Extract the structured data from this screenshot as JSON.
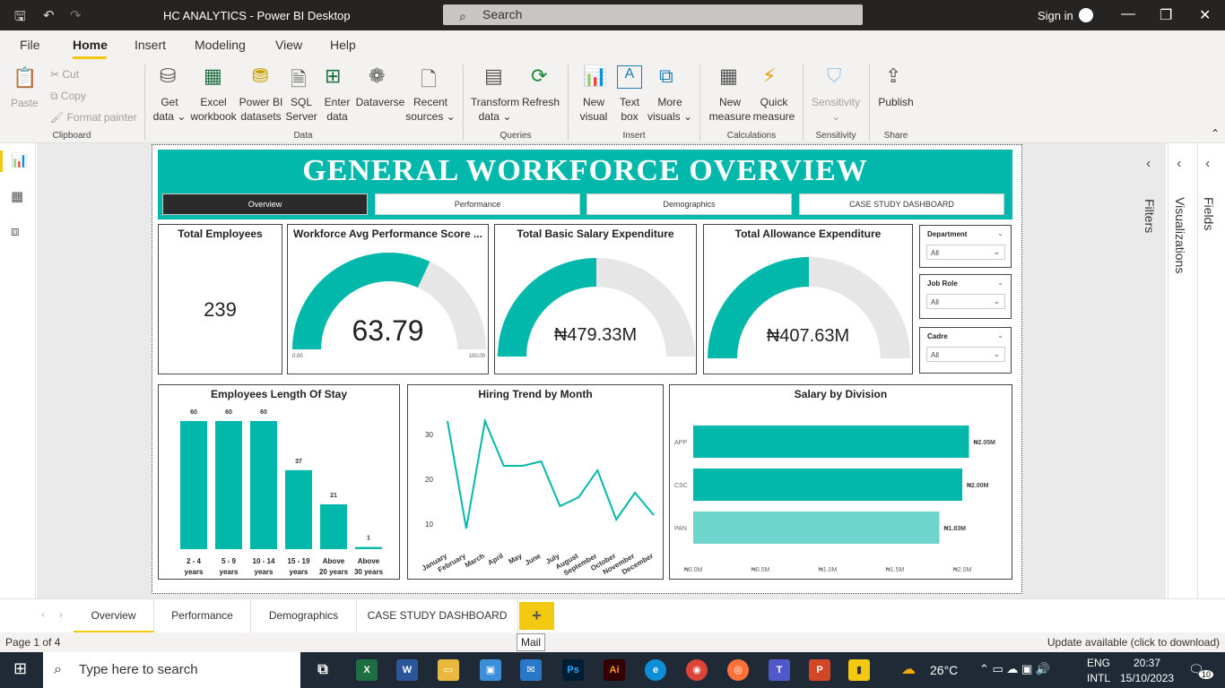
{
  "window": {
    "title": "HC ANALYTICS - Power BI Desktop",
    "search_placeholder": "Search",
    "sign_in": "Sign in"
  },
  "menu": [
    "File",
    "Home",
    "Insert",
    "Modeling",
    "View",
    "Help"
  ],
  "ribbon": {
    "clipboard": {
      "paste": "Paste",
      "cut": "Cut",
      "copy": "Copy",
      "format_painter": "Format painter",
      "group": "Clipboard"
    },
    "data": {
      "get_data": [
        "Get",
        "data ⌄"
      ],
      "excel": [
        "Excel",
        "workbook"
      ],
      "pbi": [
        "Power BI",
        "datasets"
      ],
      "sql": [
        "SQL",
        "Server"
      ],
      "enter": [
        "Enter",
        "data"
      ],
      "dataverse": [
        "Dataverse"
      ],
      "recent": [
        "Recent",
        "sources ⌄"
      ],
      "group": "Data"
    },
    "queries": {
      "transform": [
        "Transform",
        "data ⌄"
      ],
      "refresh": [
        "Refresh"
      ],
      "group": "Queries"
    },
    "insert": {
      "new_visual": [
        "New",
        "visual"
      ],
      "text_box": [
        "Text",
        "box"
      ],
      "more": [
        "More",
        "visuals ⌄"
      ],
      "group": "Insert"
    },
    "calculations": {
      "new_measure": [
        "New",
        "measure"
      ],
      "quick": [
        "Quick",
        "measure"
      ],
      "group": "Calculations"
    },
    "sensitivity": {
      "label": [
        "Sensitivity",
        "⌄"
      ],
      "group": "Sensitivity"
    },
    "share": {
      "publish": [
        "Publish"
      ],
      "group": "Share"
    }
  },
  "report": {
    "title": "GENERAL WORKFORCE OVERVIEW",
    "nav": [
      "Overview",
      "Performance",
      "Demographics",
      "CASE STUDY DASHBOARD"
    ],
    "total_employees": {
      "title": "Total Employees",
      "value": "239"
    },
    "performance": {
      "title": "Workforce Avg Performance  Score ...",
      "value": "63.79",
      "min": "0.00",
      "max": "100.00",
      "fraction": 0.6379
    },
    "basic_salary": {
      "title": "Total Basic Salary Expenditure",
      "value": "₦479.33M",
      "fraction": 0.5
    },
    "allowance": {
      "title": "Total Allowance Expenditure",
      "value": "₦407.63M",
      "fraction": 0.5
    },
    "slicers": [
      {
        "title": "Department",
        "value": "All"
      },
      {
        "title": "Job Role",
        "value": "All"
      },
      {
        "title": "Cadre",
        "value": "All"
      }
    ]
  },
  "chart_data": [
    {
      "type": "bar",
      "title": "Employees Length Of Stay",
      "categories": [
        [
          "2 - 4",
          "years"
        ],
        [
          "5 - 9",
          "years"
        ],
        [
          "10 - 14",
          "years"
        ],
        [
          "15 - 19",
          "years"
        ],
        [
          "Above",
          "20 years"
        ],
        [
          "Above",
          "30 years"
        ]
      ],
      "values": [
        60,
        60,
        60,
        37,
        21,
        1
      ],
      "color": "#01b8aa"
    },
    {
      "type": "line",
      "title": "Hiring Trend by Month",
      "categories": [
        "January",
        "February",
        "March",
        "April",
        "May",
        "June",
        "July",
        "August",
        "September",
        "October",
        "November",
        "December"
      ],
      "values": [
        33,
        9,
        33,
        23,
        23,
        24,
        14,
        16,
        22,
        11,
        17,
        12
      ],
      "yticks": [
        10,
        20,
        30
      ],
      "ylim": [
        4,
        36
      ],
      "color": "#01b8aa"
    },
    {
      "type": "bar",
      "orientation": "horizontal",
      "title": "Salary by Division",
      "categories": [
        "APP",
        "CSC",
        "PAN"
      ],
      "values": [
        2.05,
        2.0,
        1.83
      ],
      "labels": [
        "₦2.05M",
        "₦2.00M",
        "₦1.83M"
      ],
      "xticks": [
        "₦0.0M",
        "₦0.5M",
        "₦1.0M",
        "₦1.5M",
        "₦2.0M"
      ],
      "xlim": [
        0,
        2.0
      ],
      "colors": [
        "#01b8aa",
        "#01b8aa",
        "#6ed5cd"
      ]
    }
  ],
  "panes": {
    "filters": "Filters",
    "visualizations": "Visualizations",
    "fields": "Fields"
  },
  "tabs": [
    "Overview",
    "Performance",
    "Demographics",
    "CASE STUDY DASHBOARD"
  ],
  "status": {
    "page": "Page 1 of 4",
    "update": "Update available (click to download)",
    "tooltip": "Mail"
  },
  "taskbar": {
    "search": "Type here to search",
    "weather": "26°C",
    "lang1": "ENG",
    "lang2": "INTL",
    "time": "20:37",
    "date": "15/10/2023",
    "notif": "10"
  }
}
